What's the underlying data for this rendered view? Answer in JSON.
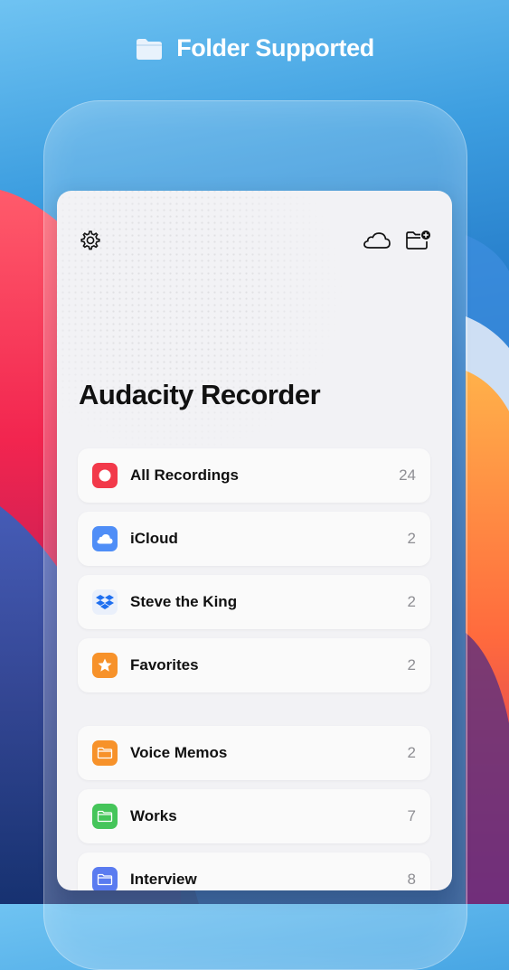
{
  "headline": {
    "text": "Folder Supported",
    "icon": "folder-icon"
  },
  "app": {
    "title": "Audacity Recorder",
    "toolbar": {
      "settings_icon": "gear-icon",
      "cloud_icon": "cloud-icon",
      "new_folder_icon": "folder-add-icon"
    }
  },
  "sources": [
    {
      "label": "All Recordings",
      "count": "24",
      "icon": "record-icon",
      "color": "#f2394a"
    },
    {
      "label": "iCloud",
      "count": "2",
      "icon": "cloud-icon",
      "color": "#4f8ef7"
    },
    {
      "label": "Steve the King",
      "count": "2",
      "icon": "dropbox-icon",
      "color": "#1e6ff0"
    },
    {
      "label": "Favorites",
      "count": "2",
      "icon": "star-icon",
      "color": "#f7922a"
    }
  ],
  "folders": [
    {
      "label": "Voice Memos",
      "count": "2",
      "icon": "folder-icon",
      "color": "#f7922a"
    },
    {
      "label": "Works",
      "count": "7",
      "icon": "folder-icon",
      "color": "#45c55a"
    },
    {
      "label": "Interview",
      "count": "8",
      "icon": "folder-icon",
      "color": "#5a7bf0"
    }
  ]
}
